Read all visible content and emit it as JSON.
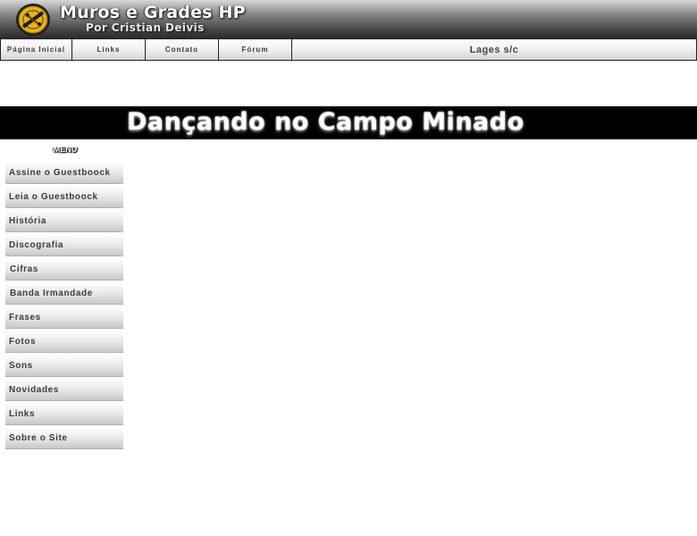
{
  "header": {
    "title": "Muros e Grades HP",
    "subtitle": "Por Cristian Deivis"
  },
  "nav": {
    "items": [
      {
        "label": "Página Inicial"
      },
      {
        "label": "Links"
      },
      {
        "label": "Contato"
      },
      {
        "label": "Fórum"
      }
    ],
    "location": "Lages s/c"
  },
  "banner": {
    "title": "Dançando no Campo Minado"
  },
  "menu": {
    "label": "MENU",
    "items": [
      {
        "label": "Assine o Guestboock"
      },
      {
        "label": "Leia o Guestboock"
      },
      {
        "label": "História"
      },
      {
        "label": "Discografia"
      },
      {
        "label": "Cifras"
      },
      {
        "label": "Banda Irmandade"
      },
      {
        "label": "Frases"
      },
      {
        "label": "Fotos"
      },
      {
        "label": "Sons"
      },
      {
        "label": "Novidades"
      },
      {
        "label": "Links"
      },
      {
        "label": "Sobre o Site"
      }
    ]
  },
  "colors": {
    "banner_bg": "#000000",
    "header_dark": "#2a2a2a",
    "menu_text": "#3c3c3c",
    "logo_yellow": "#e7b21a"
  }
}
